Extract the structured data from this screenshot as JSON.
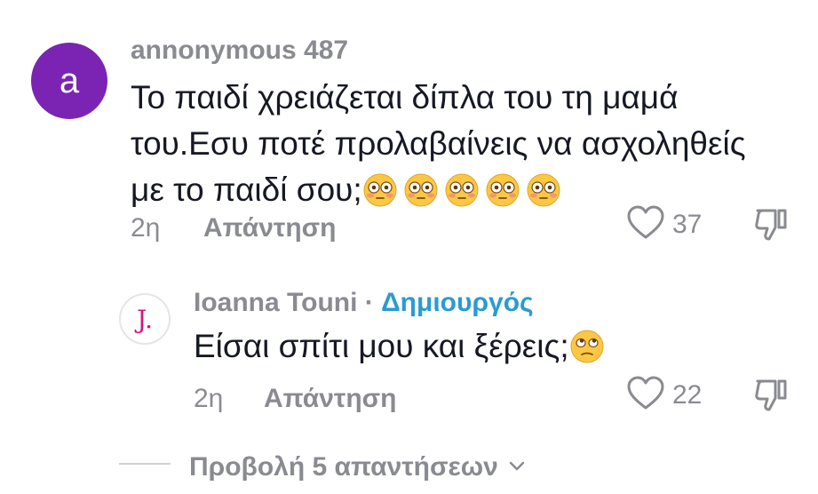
{
  "comment": {
    "avatar_letter": "a",
    "username": "annonymous 487",
    "text": "Το παιδί χρειάζεται δίπλα του τη μαμά του.Εσυ ποτέ προλαβαίνεις να ασχοληθείς με το παιδί σου;",
    "emojis": [
      "flushed-face",
      "flushed-face",
      "flushed-face",
      "flushed-face",
      "flushed-face"
    ],
    "time": "2η",
    "reply_label": "Απάντηση",
    "like_count": "37",
    "avatar_color": "#7b24b4"
  },
  "reply": {
    "avatar_letter": "J.",
    "username": "Ioanna Touni",
    "separator": " · ",
    "badge": "Δημιουργός",
    "text": "Είσαι σπίτι μου και ξέρεις;",
    "emojis": [
      "rolling-eyes-face"
    ],
    "time": "2η",
    "reply_label": "Απάντηση",
    "like_count": "22",
    "badge_color": "#2a9bd1"
  },
  "view_replies": {
    "label": "Προβολή 5 απαντήσεων"
  }
}
